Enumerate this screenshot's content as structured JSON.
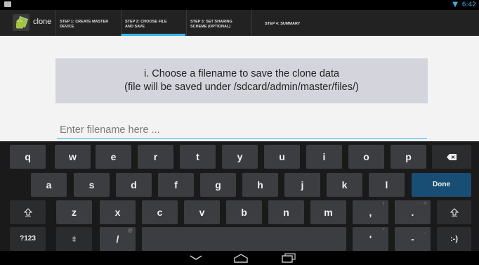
{
  "status_bar": {
    "time": "6:42",
    "wifi_icon": "wifi-icon"
  },
  "action_bar": {
    "app_title": "clone",
    "steps": [
      {
        "line1": "STEP 1: CREATE MASTER",
        "line2": "DEVICE"
      },
      {
        "line1": "STEP 2: CHOOSE FILE",
        "line2": "AND SAVE"
      },
      {
        "line1": "STEP 3: SET SHARING",
        "line2": "SCHEME (OPTIONAL)"
      },
      {
        "line1": "STEP 4: SUMMARY",
        "line2": ""
      }
    ],
    "active_step": 2,
    "accent_color": "#33b5e5"
  },
  "main": {
    "message_line1": "i. Choose a filename to save the clone data",
    "message_line2": "(file will be saved under /sdcard/admin/master/files/)",
    "filename_input": {
      "value": "",
      "placeholder": "Enter filename here ..."
    }
  },
  "keyboard": {
    "row1": [
      "q",
      "w",
      "e",
      "r",
      "t",
      "y",
      "u",
      "i",
      "o",
      "p"
    ],
    "row2": [
      "a",
      "s",
      "d",
      "f",
      "g",
      "h",
      "j",
      "k",
      "l"
    ],
    "row3": [
      "z",
      "x",
      "c",
      "v",
      "b",
      "n",
      "m",
      ",",
      "."
    ],
    "row3_sups": {
      ",": "!",
      ".": "?"
    },
    "row4": {
      "symbols": "?123",
      "settings": "⇟",
      "slash": "/",
      "slash_sup": "@",
      "apostrophe": "'",
      "apostrophe_sup": "\"",
      "dash": "-",
      "dash_sup": "_",
      "smiley": ":-)"
    },
    "done_label": "Done",
    "backspace_icon": "backspace-icon",
    "shift_icon": "shift-icon"
  },
  "nav_bar": {
    "icons": [
      "back-icon",
      "home-icon",
      "recents-icon"
    ]
  }
}
